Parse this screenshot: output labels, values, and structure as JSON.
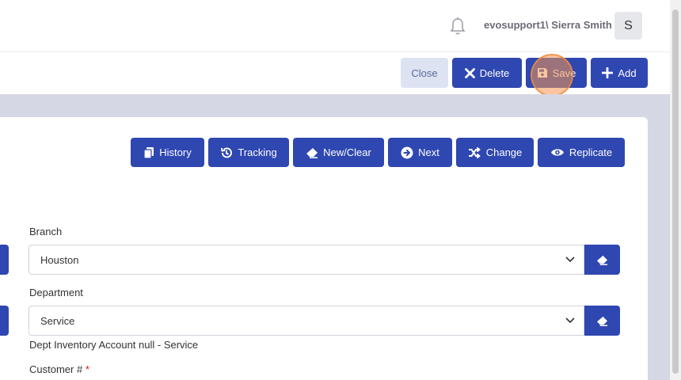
{
  "header": {
    "username": "evosupport1\\ Sierra Smith",
    "avatar_initial": "S"
  },
  "actions": {
    "close": "Close",
    "delete": "Delete",
    "save": "Save",
    "add": "Add"
  },
  "toolbar": {
    "history": "History",
    "tracking": "Tracking",
    "new_clear": "New/Clear",
    "next": "Next",
    "change": "Change",
    "replicate": "Replicate"
  },
  "form": {
    "branch": {
      "label": "Branch",
      "value": "Houston"
    },
    "department": {
      "label": "Department",
      "value": "Service"
    },
    "dept_helper": "Dept Inventory Account null - Service",
    "customer": {
      "label": "Customer #",
      "required_mark": "*"
    }
  },
  "colors": {
    "primary": "#2f47b0",
    "close_bg": "#dde3f3",
    "page_bg": "#d6d7e4",
    "highlight": "#f59650"
  }
}
